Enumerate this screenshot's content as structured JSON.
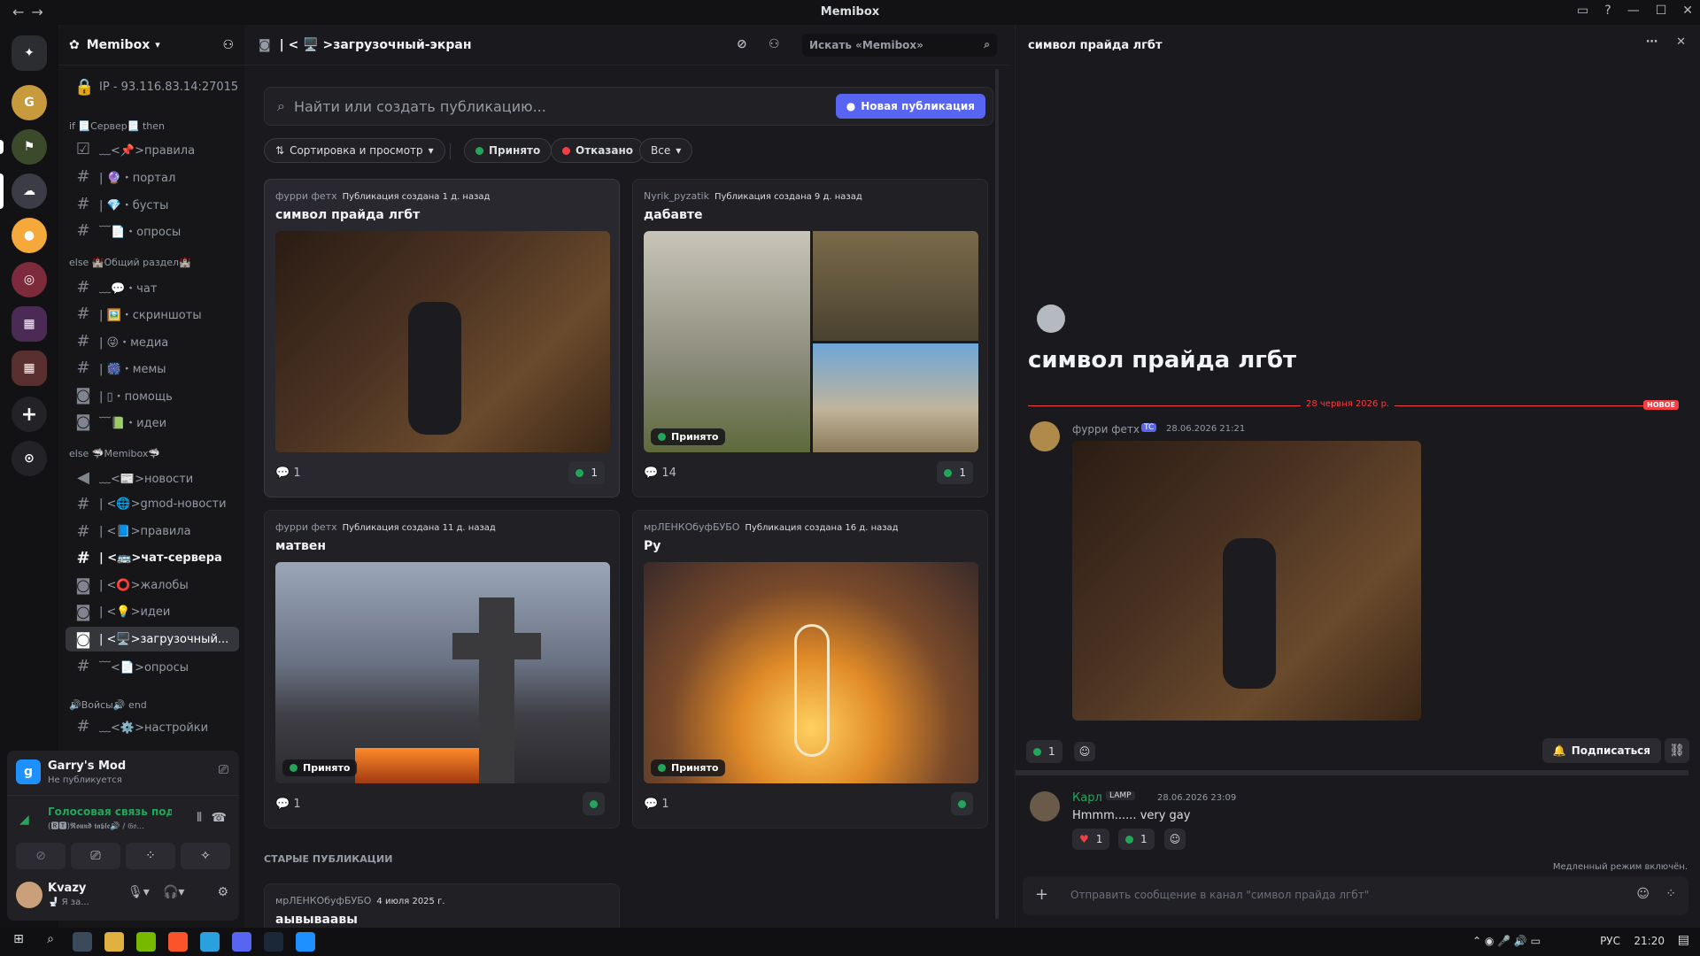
{
  "window": {
    "title": "Memibox"
  },
  "server": {
    "name": "Memibox"
  },
  "sidebar": {
    "ip_label": "IP - 93.116.83.14:27015",
    "categories": [
      {
        "label": "if 📃Сервер📃 then"
      },
      {
        "label": "else 🏰Общий раздел🏰"
      },
      {
        "label": "else 🦈Memibox🦈"
      },
      {
        "label": "🔊Войсы🔊 end"
      }
    ],
    "channels": [
      {
        "label": "﹏<📌>правила"
      },
      {
        "label": "| 🔮・портал"
      },
      {
        "label": "| 💎・бусты"
      },
      {
        "label": "﹋📄・опросы"
      },
      {
        "label": "﹏💬・чат"
      },
      {
        "label": "| 🖼️・скриншоты"
      },
      {
        "label": "| 😜・медиа"
      },
      {
        "label": "| 🎆・мемы"
      },
      {
        "label": "| ▯・помощь"
      },
      {
        "label": "﹋📗・идеи"
      },
      {
        "label": "﹏<📰>новости"
      },
      {
        "label": "| <🌐>gmod-новости"
      },
      {
        "label": "| <📘>правила"
      },
      {
        "label": "| <🚌>чат-сервера"
      },
      {
        "label": "| <⭕>жалобы"
      },
      {
        "label": "| <💡>идеи"
      },
      {
        "label": "| <🖥️>загрузочный..."
      },
      {
        "label": "﹋<📄>опросы"
      },
      {
        "label": "﹏<⚙️>настройки"
      }
    ]
  },
  "activity": {
    "game": "Garry's Mod",
    "status": "Не публикуется"
  },
  "voice": {
    "status": "Голосовая связь подк",
    "channel": "(🆁🆃)𝕽𝖔𝖚𝖓𝖉 𝖙𝖆𝖇𝖑𝖊🔊 / 𝔊𝔬..."
  },
  "user": {
    "name": "Kvazy",
    "status": "🚽 Я за..."
  },
  "main": {
    "channel_title": "| < 🖥️ >загрузочный-экран",
    "search_placeholder": "Искать «Memibox»",
    "forum_search": "Найти или создать публикацию...",
    "new_post": "Новая публикация",
    "sort": "Сортировка и просмотр",
    "tags": [
      "Принято",
      "Отказано",
      "Все"
    ],
    "old_posts": "СТАРЫЕ ПУБЛИКАЦИИ",
    "posts": [
      {
        "author": "фурри фетх",
        "created": "Публикация создана 1 д. назад",
        "title": "символ прайда лгбт",
        "comments": "1",
        "reactions": "1"
      },
      {
        "author": "Nyrik_pyzatik",
        "created": "Публикация создана 9 д. назад",
        "title": "дабавте",
        "comments": "14",
        "reactions": "1",
        "tag": "Принято"
      },
      {
        "author": "фурри фетх",
        "created": "Публикация создана 11 д. назад",
        "title": "матвен",
        "comments": "1",
        "tag": "Принято"
      },
      {
        "author": "мрЛЕНКОбуфБУБО",
        "created": "Публикация создана 16 д. назад",
        "title": "Ру",
        "comments": "1",
        "tag": "Принято"
      },
      {
        "author": "мрЛЕНКОбуфБУБО",
        "created": "4 июля 2025 г.",
        "title": "аывываавы"
      }
    ]
  },
  "thread": {
    "header": "символ прайда лгбт",
    "title": "символ прайда лгбт",
    "divider_date": "28 червня 2026 р.",
    "new_badge": "НОВОЕ",
    "op": {
      "author": "фурри фетх",
      "badge": "TC",
      "time": "28.06.2026 21:21",
      "reactions": "1"
    },
    "subscribe": "Подписаться",
    "reply": {
      "author": "Карл",
      "tag": "LAMP",
      "time": "28.06.2026 23:09",
      "text": "Hmmm...... very gay",
      "r1": "1",
      "r2": "1"
    },
    "slowmode": "Медленный режим включён.",
    "composer": "Отправить сообщение в канал \"символ прайда лгбт\""
  },
  "taskbar": {
    "lang": "РУС",
    "time": "21:20"
  }
}
